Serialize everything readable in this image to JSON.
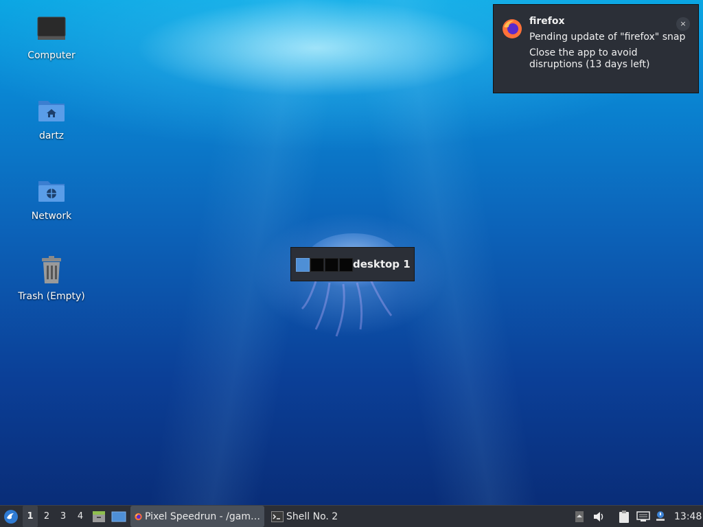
{
  "desktop": {
    "icons": [
      {
        "label": "Computer",
        "icon": "computer-icon"
      },
      {
        "label": "dartz",
        "icon": "home-folder-icon"
      },
      {
        "label": "Network",
        "icon": "network-folder-icon"
      },
      {
        "label": "Trash (Empty)",
        "icon": "trash-icon"
      }
    ]
  },
  "notification": {
    "app": "firefox",
    "message_line1": "Pending update of \"firefox\" snap",
    "message_line2": "Close the app to avoid disruptions (13 days left)",
    "close_glyph": "×"
  },
  "workspace_osd": {
    "label": "desktop 1",
    "count": 4,
    "active": 1
  },
  "taskbar": {
    "menu_icon": "lubuntu-menu-icon",
    "workspaces": [
      "1",
      "2",
      "3",
      "4"
    ],
    "active_workspace": "1",
    "quicklaunch": [
      "file-manager-icon",
      "show-desktop-icon"
    ],
    "tasks": [
      {
        "label": "Pixel Speedrun - /gam…",
        "icon": "firefox-icon",
        "active": true
      },
      {
        "label": "Shell No. 2",
        "icon": "terminal-icon",
        "active": false
      }
    ],
    "tray": [
      "tray-up-arrow-icon",
      "volume-icon",
      "clipboard-icon",
      "network-icon",
      "update-notifier-icon"
    ],
    "clock": "13:48"
  },
  "colors": {
    "panel": "#2c2f36",
    "accent": "#4e8fd6"
  }
}
